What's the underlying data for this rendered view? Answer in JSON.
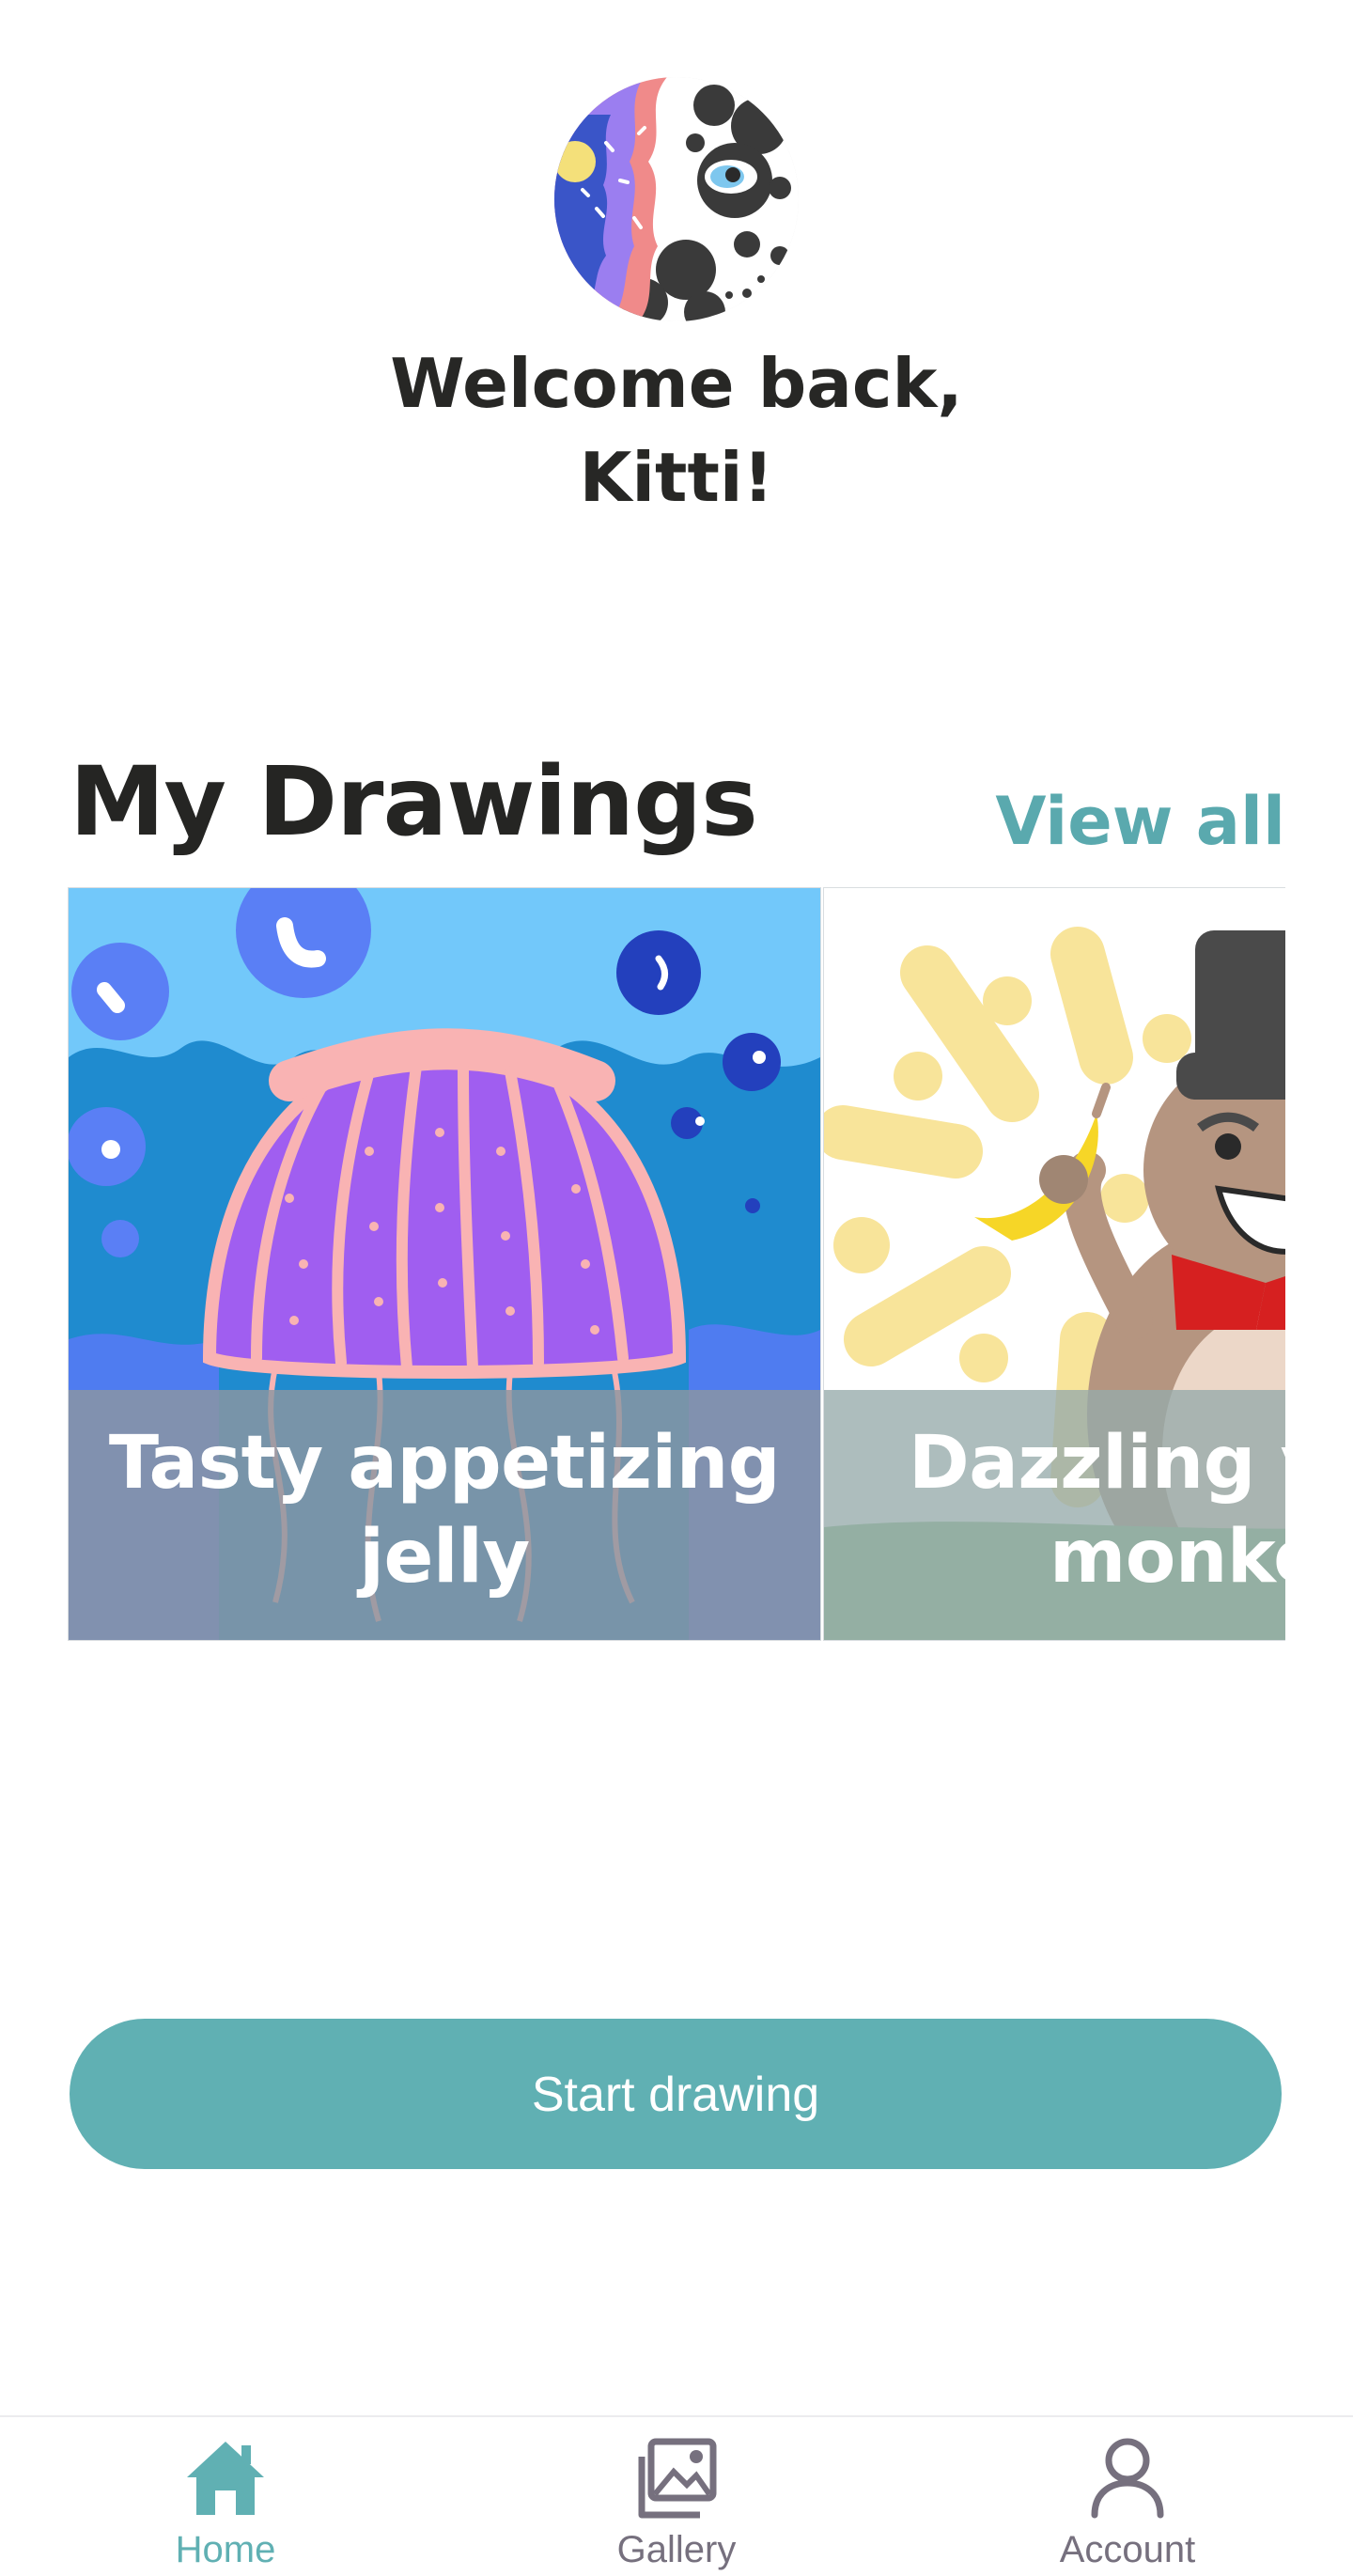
{
  "header": {
    "welcome_line1": "Welcome back,",
    "welcome_line2": "Kitti!"
  },
  "drawings": {
    "title": "My Drawings",
    "view_all_label": "View all",
    "cards": [
      {
        "title_line1": "Tasty appetizing",
        "title_line2": "jelly"
      },
      {
        "title_line1": "Dazzling y",
        "title_line2": "monke"
      }
    ]
  },
  "actions": {
    "start_label": "Start drawing"
  },
  "nav": {
    "items": [
      {
        "label": "Home",
        "icon": "home-icon",
        "active": true
      },
      {
        "label": "Gallery",
        "icon": "gallery-icon",
        "active": false
      },
      {
        "label": "Account",
        "icon": "account-icon",
        "active": false
      }
    ]
  },
  "colors": {
    "accent": "#60b0b3",
    "nav_inactive": "#76707e",
    "text": "#272725"
  }
}
